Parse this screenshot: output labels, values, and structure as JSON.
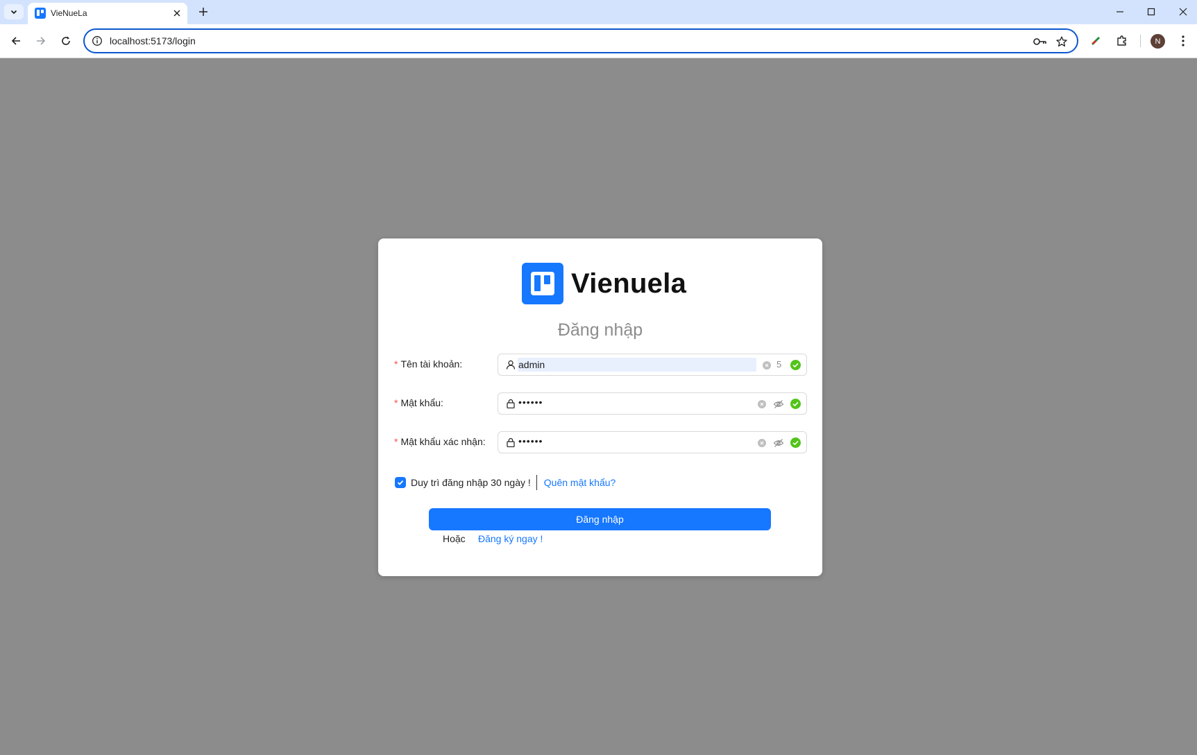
{
  "browser": {
    "tab_title": "VieNueLa",
    "url": "localhost:5173/login",
    "profile_initial": "N"
  },
  "brand": {
    "name": "Vienuela",
    "color": "#1677ff"
  },
  "login": {
    "title": "Đăng nhập",
    "username": {
      "label": "Tên tài khoản",
      "value": "admin",
      "char_count": "5",
      "required_mark": "*"
    },
    "password": {
      "label": "Mật khẩu",
      "masked_value": "••••••",
      "required_mark": "*"
    },
    "confirm_password": {
      "label": "Mật khẩu xác nhận",
      "masked_value": "••••••",
      "required_mark": "*"
    },
    "remember_label": "Duy trì đăng nhập 30 ngày !",
    "remember_checked": true,
    "forgot_link": "Quên mật khẩu?",
    "submit_label": "Đăng nhập",
    "or_text": "Hoặc",
    "register_link": "Đăng ký ngay !"
  },
  "colors": {
    "accent": "#1677ff",
    "success": "#52c41a",
    "required": "#ff4d4f",
    "overlay": "#8c8c8c"
  }
}
